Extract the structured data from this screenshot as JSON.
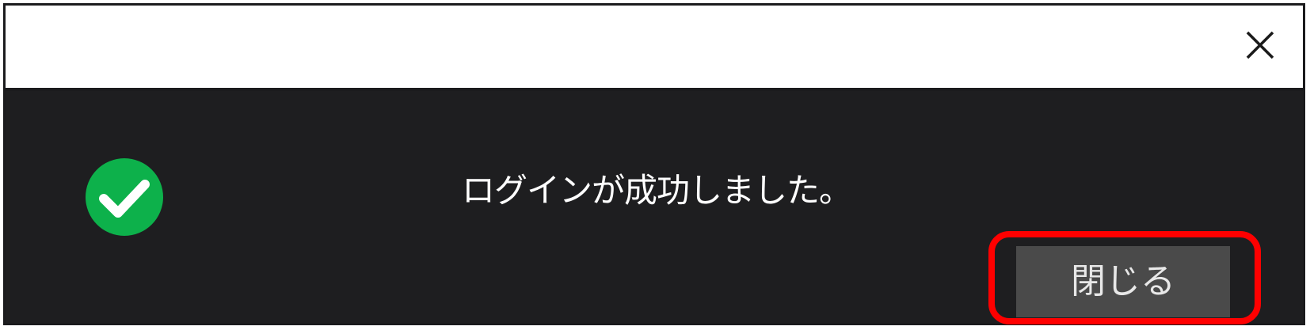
{
  "dialog": {
    "title_close_icon": "close-icon",
    "status_icon": "check-circle-icon",
    "message": "ログインが成功しました。",
    "close_button_label": "閉じる"
  },
  "colors": {
    "background": "#1e1e20",
    "titlebar": "#ffffff",
    "button": "#4a4a4a",
    "success": "#0db14b",
    "highlight": "#ff0000"
  }
}
